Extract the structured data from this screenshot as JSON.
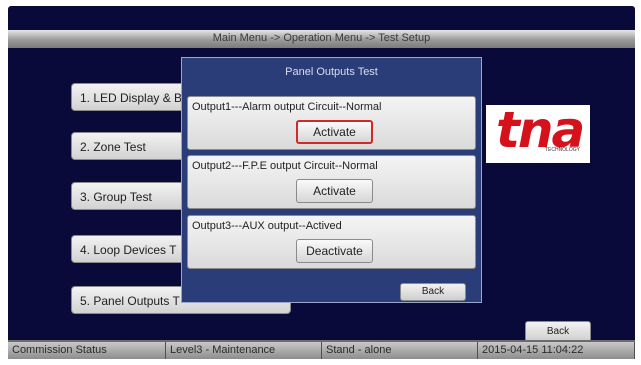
{
  "header": {
    "breadcrumb": "Main Menu -> Operation Menu -> Test Setup"
  },
  "menu": {
    "items": [
      {
        "label": "1. LED Display & B"
      },
      {
        "label": "2. Zone Test"
      },
      {
        "label": "3. Group Test"
      },
      {
        "label": "4. Loop Devices T"
      },
      {
        "label": "5. Panel Outputs T"
      }
    ]
  },
  "logo": {
    "text": "tna",
    "subtext": "TECHNOLOGY"
  },
  "dialog": {
    "title": "Panel Outputs Test",
    "outputs": [
      {
        "label": "Output1---Alarm output Circuit--Normal",
        "button": "Activate"
      },
      {
        "label": "Output2---F.P.E output Circuit--Normal",
        "button": "Activate"
      },
      {
        "label": "Output3---AUX output--Actived",
        "button": "Deactivate"
      }
    ],
    "back_label": "Back"
  },
  "main": {
    "back_label": "Back"
  },
  "statusbar": {
    "commission": "Commission Status",
    "level": "Level3 - Maintenance",
    "mode": "Stand - alone",
    "datetime": "2015-04-15 11:04:22"
  },
  "colors": {
    "background": "#0a0a3a",
    "dialog": "#2a3d78",
    "accent": "#d12828",
    "logo": "#d5121b"
  }
}
